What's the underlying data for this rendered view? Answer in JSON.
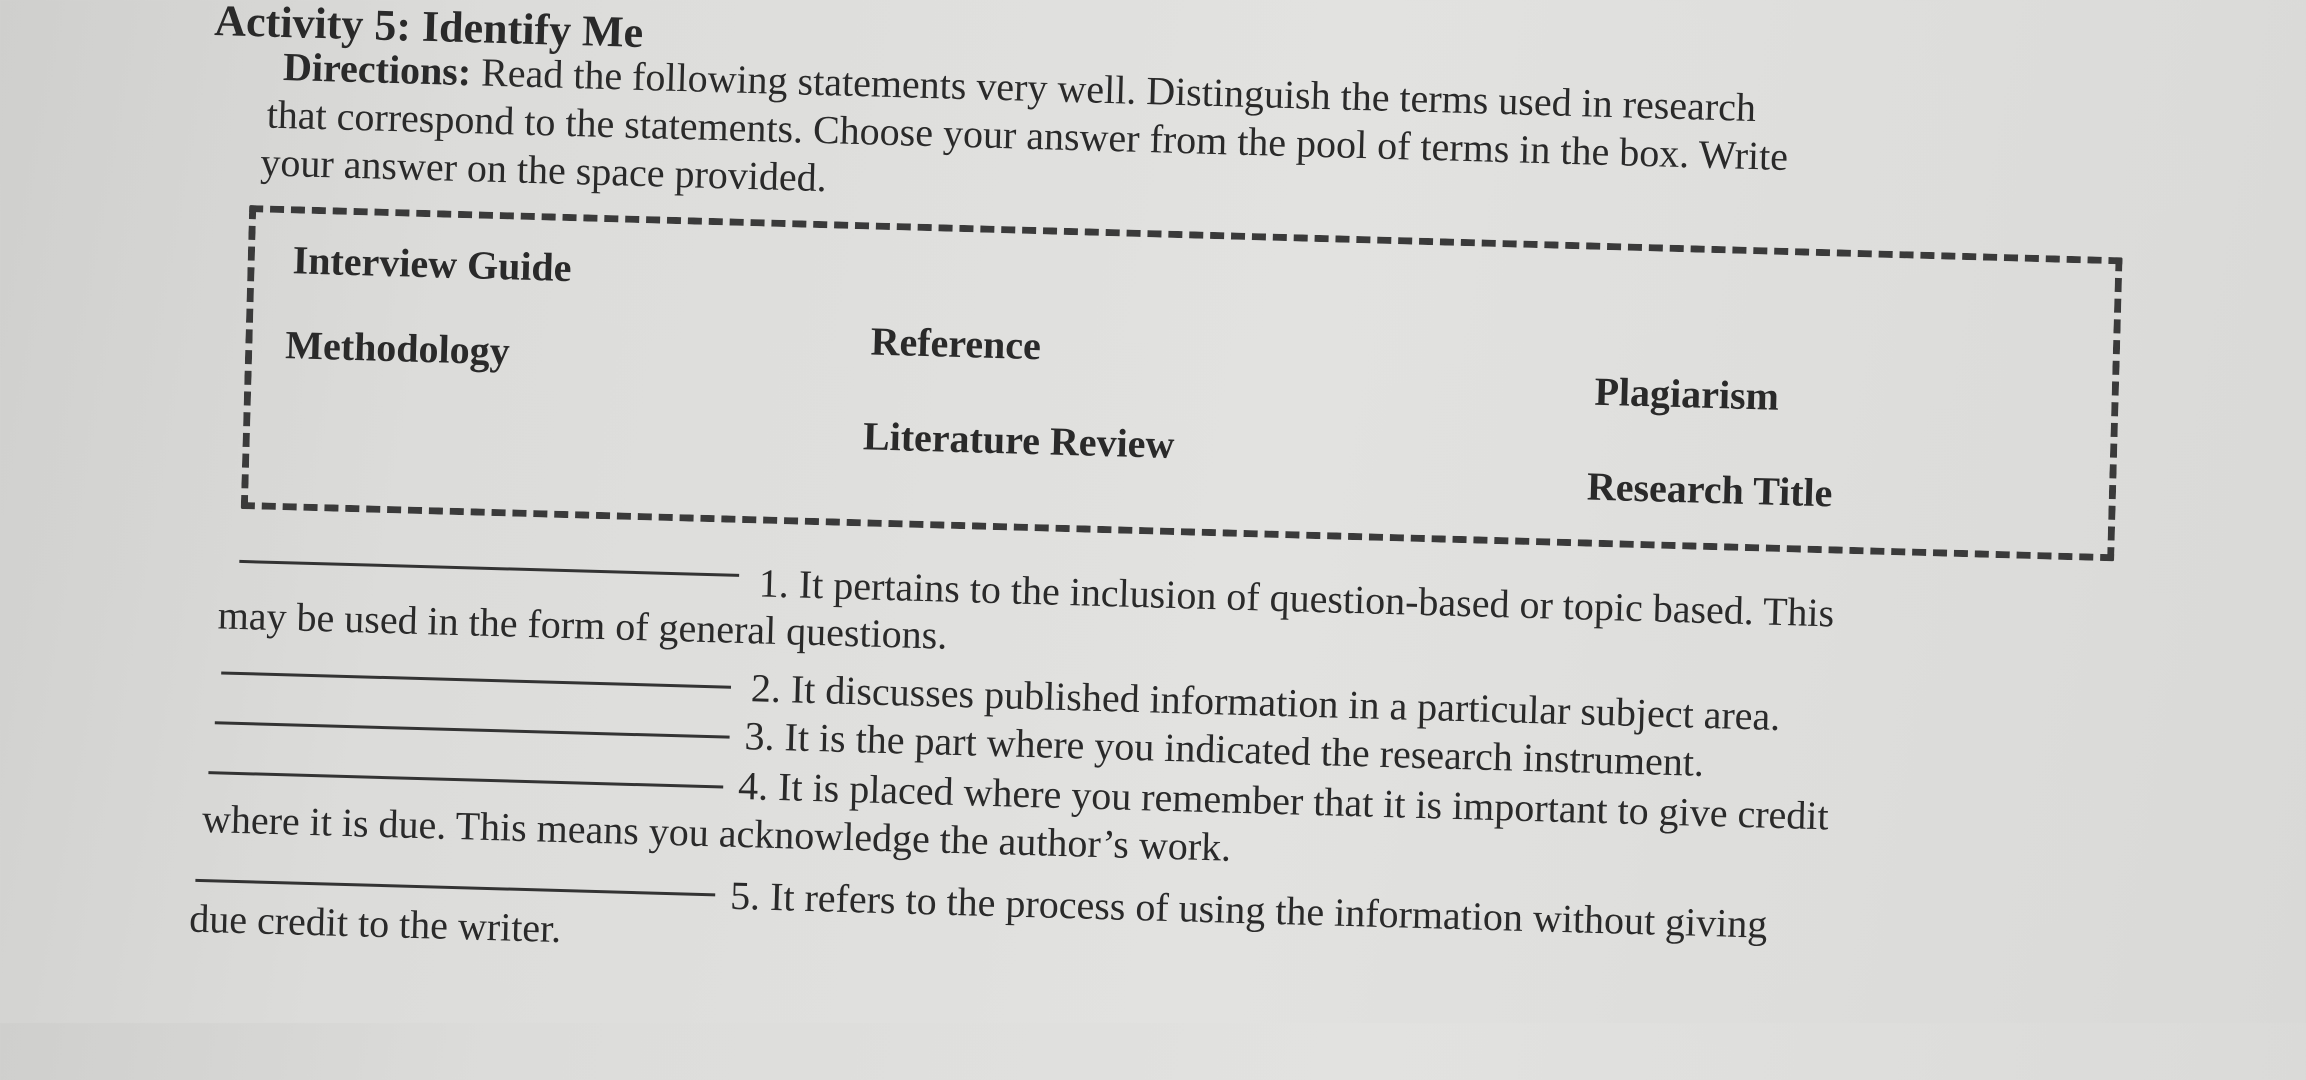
{
  "activity": {
    "title": "Activity 5: Identify Me",
    "directions_label": "Directions:",
    "directions_lines": [
      " Read the following statements very well. Distinguish the terms used in research",
      "that correspond to the statements. Choose your answer from the pool of terms in the box. Write",
      "your answer on the space provided."
    ]
  },
  "term_box": {
    "terms": [
      "Interview Guide",
      "Reference",
      "Plagiarism",
      "Methodology",
      "Literature Review",
      "Research Title"
    ]
  },
  "questions": [
    {
      "number": 1,
      "answer": "",
      "line1": "1. It pertains to the inclusion of question-based or topic based. This",
      "line2": "may be used in the form of general questions."
    },
    {
      "number": 2,
      "answer": "",
      "line1": "2. It discusses published information in a particular subject area."
    },
    {
      "number": 3,
      "answer": "",
      "line1": "3. It is the part where you indicated the research instrument."
    },
    {
      "number": 4,
      "answer": "",
      "line1": "4. It is placed where you remember that it is important to give credit",
      "line2": "where it is due. This means you acknowledge the author’s work."
    },
    {
      "number": 5,
      "answer": "",
      "line1": "5.  It refers to the process of using the information without giving",
      "line2": "due credit to the writer."
    }
  ]
}
